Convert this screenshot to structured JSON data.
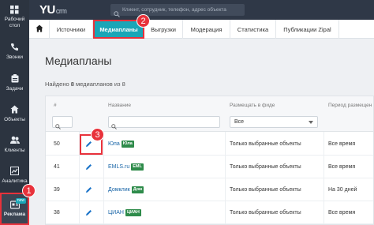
{
  "sidebar": {
    "items": [
      {
        "label": "Рабочий\nстол",
        "icon": "grid-icon"
      },
      {
        "label": "Звонки",
        "icon": "phone-icon"
      },
      {
        "label": "Задачи",
        "icon": "clipboard-icon"
      },
      {
        "label": "Объекты",
        "icon": "home-icon"
      },
      {
        "label": "Клиенты",
        "icon": "users-icon"
      },
      {
        "label": "Аналитика",
        "icon": "chart-icon"
      },
      {
        "label": "Реклама",
        "icon": "ad-icon",
        "badge": "new"
      }
    ]
  },
  "header": {
    "logo": "YU",
    "logo_suffix": "crm",
    "search_placeholder": "Клиент, сотрудник, телефон, адрес объекта"
  },
  "tabs": [
    "Источники",
    "Медиапланы",
    "Выгрузки",
    "Модерация",
    "Статистика",
    "Публикации Zipal"
  ],
  "callouts": [
    "1",
    "2",
    "3"
  ],
  "main": {
    "title": "Медиапланы",
    "found_prefix": "Найдено ",
    "found_count": "8",
    "found_suffix": " медиапланов из 8"
  },
  "table": {
    "headers": [
      "#",
      "Название",
      "Размещать в фиде",
      "Период размещен"
    ],
    "feed_filter_value": "Все",
    "rows": [
      {
        "id": "50",
        "name": "Юла",
        "tag": "Юла",
        "feed": "Только выбранные объекты",
        "period": "Все время"
      },
      {
        "id": "41",
        "name": "EMLS.ru",
        "tag": "EML",
        "feed": "Только выбранные объекты",
        "period": "Все время"
      },
      {
        "id": "39",
        "name": "Домклик",
        "tag": "Дом",
        "feed": "Только выбранные объекты",
        "period": "На 30 дней"
      },
      {
        "id": "38",
        "name": "ЦИАН",
        "tag": "ЦИАН",
        "feed": "Только выбранные объекты",
        "period": "Все время"
      }
    ]
  },
  "colors": {
    "accent": "#1aa6b7",
    "highlight": "#e8323b",
    "sidebar": "#2c3440",
    "tag": "#2e8b4a"
  }
}
